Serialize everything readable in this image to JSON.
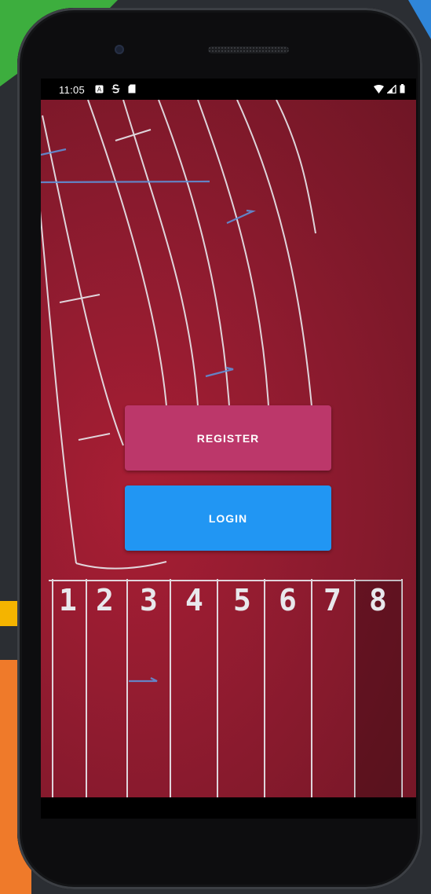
{
  "status_bar": {
    "time": "11:05",
    "left_icons": [
      "notification-a-icon",
      "s-sync-icon",
      "sd-card-icon"
    ],
    "right_icons": [
      "wifi-icon",
      "signal-icon",
      "battery-icon"
    ]
  },
  "track": {
    "lane_numbers": [
      "1",
      "2",
      "3",
      "4",
      "5",
      "6",
      "7",
      "8"
    ]
  },
  "buttons": {
    "register_label": "REGISTER",
    "login_label": "LOGIN"
  },
  "colors": {
    "register": "#bc376a",
    "login": "#2196f3",
    "track": "#a81e34"
  }
}
